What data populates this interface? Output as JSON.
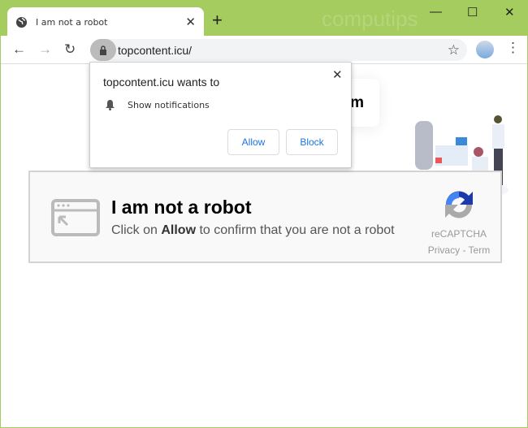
{
  "browser": {
    "tab_title": "I am not a robot",
    "watermark": "computips",
    "url": "topcontent.icu/",
    "accent": "#a4cc5e"
  },
  "popup": {
    "heading": "topcontent.icu wants to",
    "permission": "Show notifications",
    "allow_label": "Allow",
    "block_label": "Block"
  },
  "page": {
    "background_card_text": "m",
    "captcha": {
      "title": "I am not a robot",
      "sub_prefix": "Click on ",
      "sub_bold": "Allow",
      "sub_suffix": " to confirm that you are not a robot",
      "brand": "reCAPTCHA",
      "links": "Privacy - Term"
    }
  }
}
